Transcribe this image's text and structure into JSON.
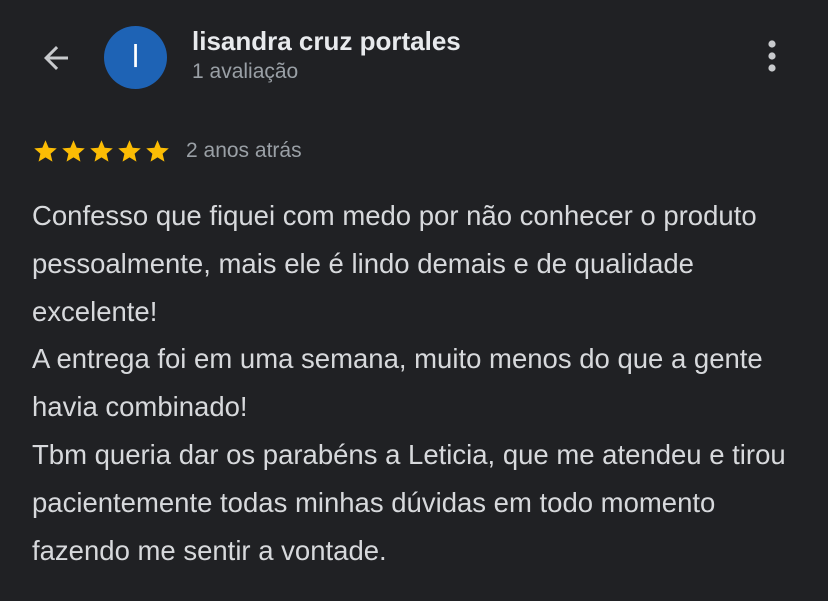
{
  "header": {
    "back_icon": "arrow-back-icon",
    "avatar_initial": "l",
    "avatar_color": "#1e63b5",
    "user_name": "lisandra cruz portales",
    "review_count": "1 avaliação",
    "more_icon": "more-vert-icon"
  },
  "review": {
    "rating": 5,
    "max_rating": 5,
    "star_color": "#fbbc04",
    "time_ago": "2 anos atrás",
    "text": "Confesso que fiquei com medo por não conhecer o produto pessoalmente, mais ele é lindo demais e de qualidade excelente!\nA entrega foi em uma semana, muito menos do que a gente havia combinado!\nTbm queria dar os parabéns a Leticia, que me atendeu e tirou pacientemente todas minhas dúvidas em todo momento fazendo me sentir a vontade."
  },
  "colors": {
    "background": "#202124",
    "primary_text": "#e8eaed",
    "secondary_text": "#9aa0a6"
  }
}
